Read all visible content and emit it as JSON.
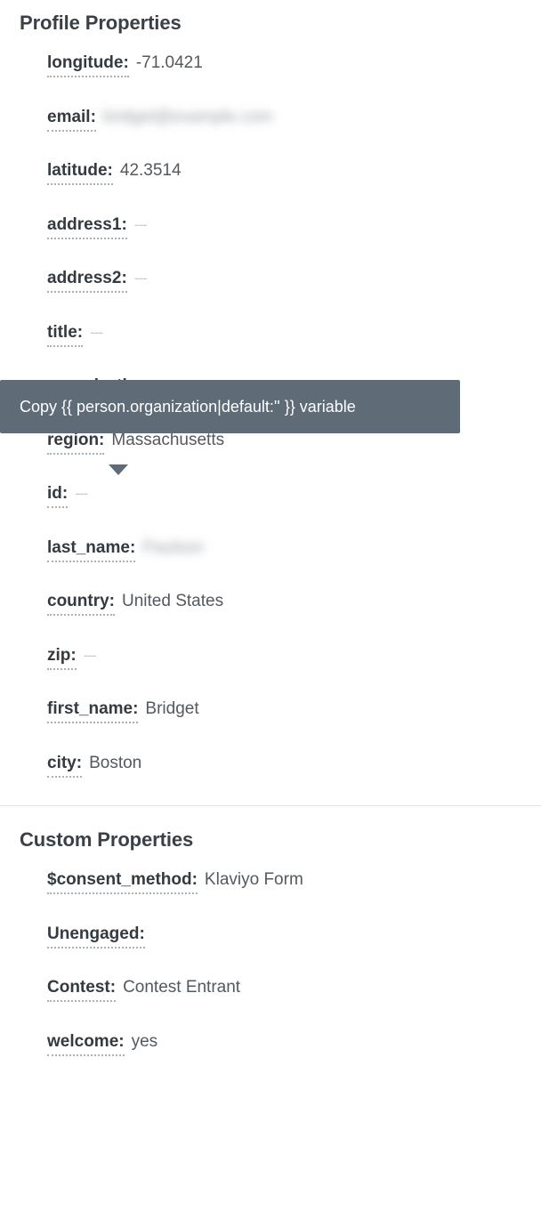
{
  "profile_section": {
    "title": "Profile Properties",
    "rows": [
      {
        "label": "longitude:",
        "value": "-71.0421",
        "state": "normal"
      },
      {
        "label": "email:",
        "value": "bridget@example.com",
        "state": "redacted"
      },
      {
        "label": "latitude:",
        "value": "42.3514",
        "state": "normal"
      },
      {
        "label": "address1:",
        "value": "---",
        "state": "empty"
      },
      {
        "label": "address2:",
        "value": "---",
        "state": "empty"
      },
      {
        "label": "title:",
        "value": "---",
        "state": "empty"
      },
      {
        "label": "organization:",
        "value": "---",
        "state": "empty"
      },
      {
        "label": "region:",
        "value": "Massachusetts",
        "state": "normal"
      },
      {
        "label": "id:",
        "value": "---",
        "state": "empty"
      },
      {
        "label": "last_name:",
        "value": "Paulson",
        "state": "redacted"
      },
      {
        "label": "country:",
        "value": "United States",
        "state": "normal"
      },
      {
        "label": "zip:",
        "value": "---",
        "state": "empty"
      },
      {
        "label": "first_name:",
        "value": "Bridget",
        "state": "normal"
      },
      {
        "label": "city:",
        "value": "Boston",
        "state": "normal"
      }
    ]
  },
  "custom_section": {
    "title": "Custom Properties",
    "rows": [
      {
        "label": "$consent_method:",
        "value": "Klaviyo Form",
        "state": "normal"
      },
      {
        "label": "Unengaged:",
        "value": "",
        "state": "normal"
      },
      {
        "label": "Contest:",
        "value": "Contest Entrant",
        "state": "normal"
      },
      {
        "label": "welcome:",
        "value": "yes",
        "state": "normal"
      }
    ]
  },
  "tooltip": {
    "text": "Copy {{ person.organization|default:'' }} variable",
    "background_color": "#5f6c77",
    "text_color": "#ffffff"
  },
  "colors": {
    "label_text": "#333a40",
    "value_text": "#53595f",
    "empty_value_text": "#c6cbcf",
    "heading_text": "#3a4047",
    "divider": "#e2e4e6",
    "page_background": "#ffffff"
  }
}
